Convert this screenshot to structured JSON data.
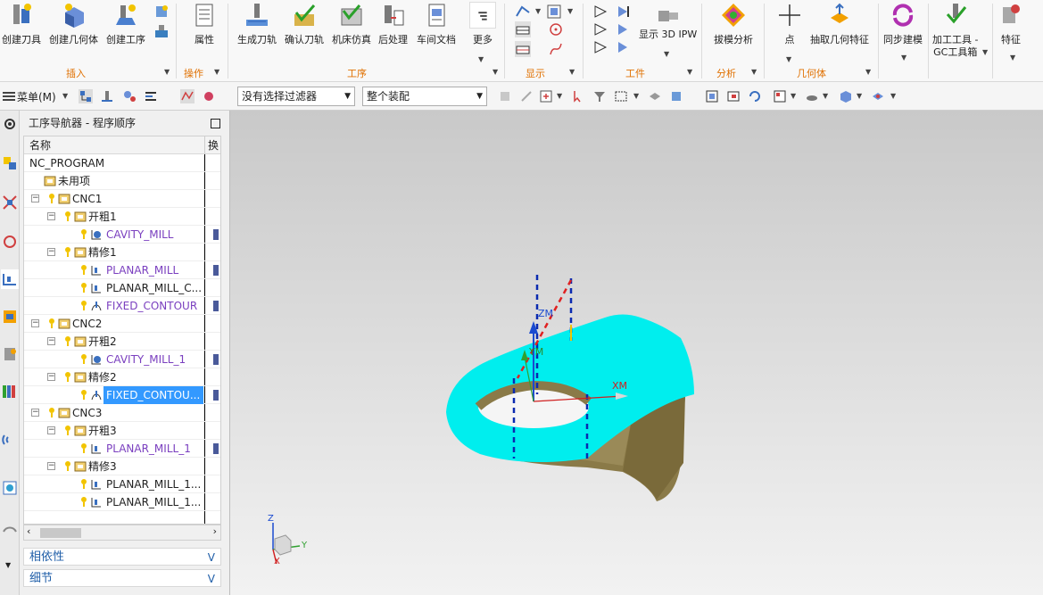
{
  "ribbon": {
    "insert_buttons": [
      "创建刀具",
      "创建几何体",
      "创建工序"
    ],
    "insert_group": "插入",
    "ops_buttons": [
      "属性"
    ],
    "ops_group": "操作",
    "proc_buttons": [
      "生成刀轨",
      "确认刀轨",
      "机床仿真",
      "后处理",
      "车间文档",
      "更多"
    ],
    "proc_group": "工序",
    "display_group": "显示",
    "workpiece_buttons": [
      "显示 3D IPW"
    ],
    "workpiece_group": "工件",
    "analysis_buttons": [
      "拔模分析"
    ],
    "analysis_group": "分析",
    "geometry_buttons": [
      "点",
      "抽取几何特征"
    ],
    "geometry_group": "几何体",
    "sync_button": "同步建模",
    "tools_button_l1": "加工工具 -",
    "tools_button_l2": "GC工具箱",
    "feature_button": "特征"
  },
  "toolbar": {
    "menu_label": "菜单(M)",
    "filter_value": "没有选择过滤器",
    "assembly_value": "整个装配"
  },
  "navigator": {
    "title": "工序导航器 - 程序顺序",
    "col_name": "名称",
    "col_tool": "换",
    "rows": [
      "NC_PROGRAM",
      "未用项",
      "CNC1",
      "开粗1",
      "CAVITY_MILL",
      "精修1",
      "PLANAR_MILL",
      "PLANAR_MILL_C...",
      "FIXED_CONTOUR",
      "CNC2",
      "开粗2",
      "CAVITY_MILL_1",
      "精修2",
      "FIXED_CONTOU...",
      "CNC3",
      "开粗3",
      "PLANAR_MILL_1",
      "精修3",
      "PLANAR_MILL_1...",
      "PLANAR_MILL_1..."
    ],
    "dependency_label": "相依性",
    "details_label": "细节"
  },
  "viewport": {
    "zm_label": "ZM",
    "ym_label": "YM",
    "xm_label": "XM",
    "triad_z": "Z",
    "triad_y": "Y",
    "triad_x": "X"
  },
  "colors": {
    "accent_orange": "#e07000",
    "selection_blue": "#3399ff",
    "op_purple": "#7a3fbf",
    "part_cyan": "#00eeee",
    "part_body": "#8a7a48"
  }
}
